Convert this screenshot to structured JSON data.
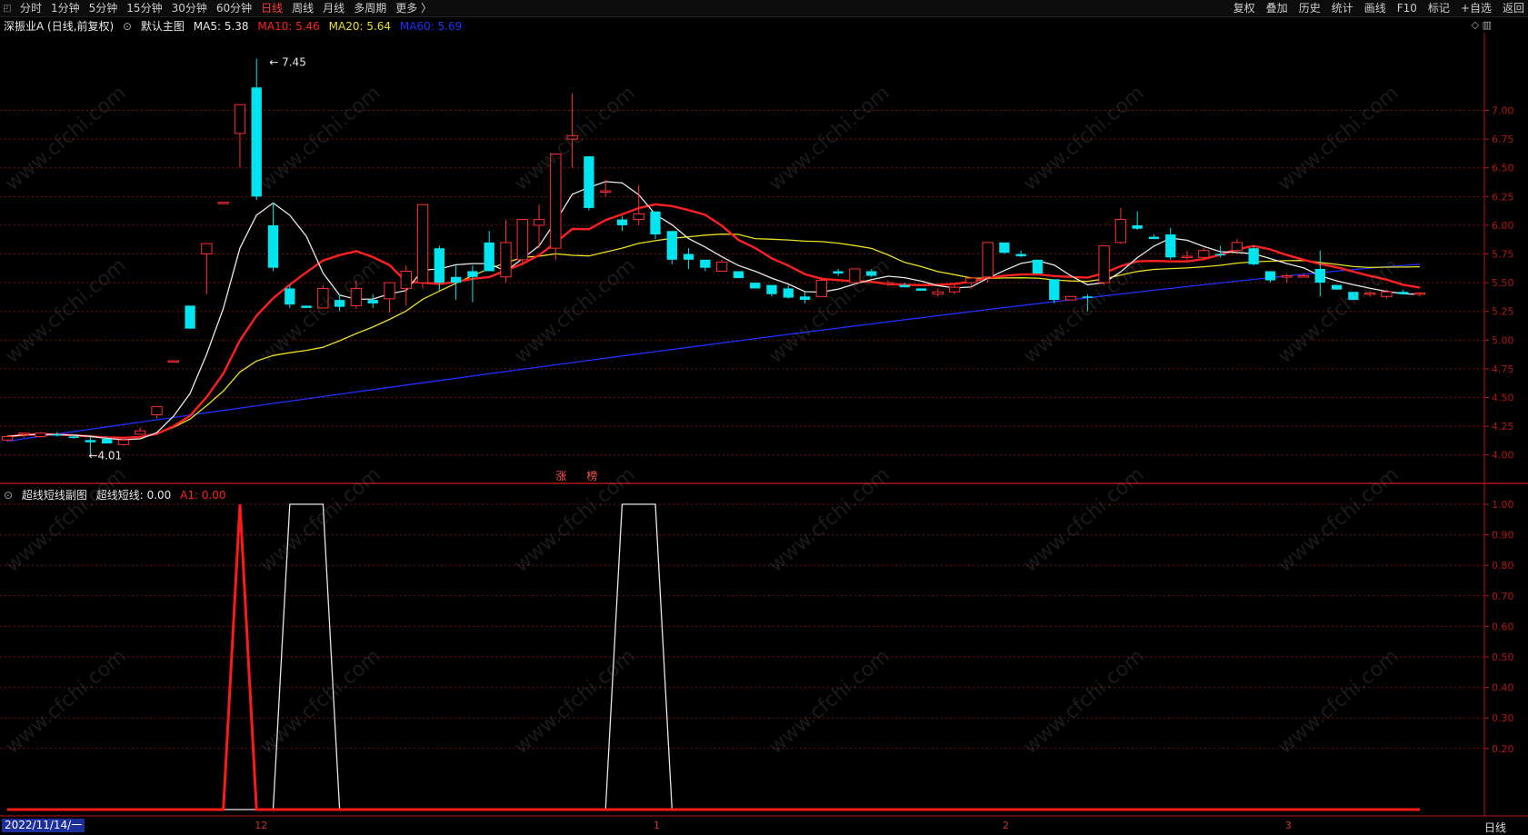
{
  "toolbar": {
    "periods": [
      "分时",
      "1分钟",
      "5分钟",
      "15分钟",
      "30分钟",
      "60分钟",
      "日线",
      "周线",
      "月线",
      "多周期",
      "更多 〉"
    ],
    "active_period": "日线",
    "right_buttons": [
      "复权",
      "叠加",
      "历史",
      "统计",
      "画线",
      "F10",
      "标记",
      "+自选",
      "返回"
    ]
  },
  "main_chart": {
    "stock_label": "深振业A (日线,前复权)",
    "template": "默认主图",
    "ma": [
      {
        "label": "MA5: 5.38",
        "color": "#e8e8e8"
      },
      {
        "label": "MA10: 5.46",
        "color": "#ff2020"
      },
      {
        "label": "MA20: 5.64",
        "color": "#e8e020"
      },
      {
        "label": "MA60: 5.69",
        "color": "#2030ff"
      }
    ],
    "high_label": "7.45",
    "low_label": "4.01",
    "marker_text": [
      "涨",
      "榜"
    ],
    "y_ticks": [
      "7.00",
      "6.75",
      "6.50",
      "6.25",
      "6.00",
      "5.75",
      "5.50",
      "5.25",
      "5.00",
      "4.75",
      "4.50",
      "4.25",
      "4.00"
    ]
  },
  "sub_chart": {
    "title": "超线短线副图",
    "line1": "超线短线: 0.00",
    "line2": "A1: 0.00",
    "y_ticks": [
      "1.00",
      "0.90",
      "0.80",
      "0.70",
      "0.60",
      "0.50",
      "0.40",
      "0.30",
      "0.20"
    ]
  },
  "x_axis": {
    "date": "2022/11/14/一",
    "months": [
      "12",
      "1",
      "2",
      "3"
    ],
    "period_label": "日线"
  },
  "watermark": "www.cfchi.com",
  "colors": {
    "up": "#ff3030",
    "down": "#00e5f0",
    "grid": "#7a1010",
    "frame": "#b01818"
  },
  "chart_data": [
    {
      "type": "candlestick",
      "title": "深振业A (日线,前复权)",
      "ylim": [
        3.8,
        7.55
      ],
      "series": [
        {
          "name": "MA5",
          "final": 5.38
        },
        {
          "name": "MA10",
          "final": 5.46
        },
        {
          "name": "MA20",
          "final": 5.64
        },
        {
          "name": "MA60",
          "final": 5.69
        }
      ],
      "ohlc": [
        [
          4.13,
          4.17,
          4.12,
          4.16
        ],
        [
          4.18,
          4.19,
          4.15,
          4.19
        ],
        [
          4.16,
          4.2,
          4.15,
          4.19
        ],
        [
          4.18,
          4.2,
          4.16,
          4.17
        ],
        [
          4.16,
          4.18,
          4.14,
          4.15
        ],
        [
          4.13,
          4.16,
          4.01,
          4.11
        ],
        [
          4.14,
          4.16,
          4.1,
          4.1
        ],
        [
          4.09,
          4.13,
          4.08,
          4.13
        ],
        [
          4.18,
          4.24,
          4.18,
          4.21
        ],
        [
          4.35,
          4.42,
          4.32,
          4.42
        ],
        [
          4.82,
          4.82,
          4.82,
          4.82
        ],
        [
          5.3,
          5.3,
          5.1,
          5.1
        ],
        [
          5.75,
          5.84,
          5.4,
          5.84
        ],
        [
          6.2,
          6.2,
          6.2,
          6.2
        ],
        [
          6.8,
          7.05,
          6.5,
          7.05
        ],
        [
          7.2,
          7.45,
          6.22,
          6.25
        ],
        [
          6.0,
          6.2,
          5.6,
          5.63
        ],
        [
          5.45,
          5.48,
          5.28,
          5.31
        ],
        [
          5.3,
          5.3,
          5.28,
          5.28
        ],
        [
          5.28,
          5.48,
          5.28,
          5.45
        ],
        [
          5.35,
          5.4,
          5.25,
          5.29
        ],
        [
          5.3,
          5.52,
          5.27,
          5.45
        ],
        [
          5.35,
          5.4,
          5.28,
          5.32
        ],
        [
          5.36,
          5.5,
          5.24,
          5.5
        ],
        [
          5.45,
          5.65,
          5.3,
          5.6
        ],
        [
          5.5,
          6.18,
          5.45,
          6.18
        ],
        [
          5.8,
          5.82,
          5.43,
          5.5
        ],
        [
          5.55,
          5.65,
          5.35,
          5.5
        ],
        [
          5.6,
          5.65,
          5.33,
          5.55
        ],
        [
          5.85,
          5.95,
          5.6,
          5.6
        ],
        [
          5.55,
          6.05,
          5.5,
          5.85
        ],
        [
          5.7,
          6.0,
          5.65,
          6.05
        ],
        [
          6.0,
          6.18,
          5.8,
          6.05
        ],
        [
          5.8,
          6.6,
          5.7,
          6.62
        ],
        [
          6.75,
          7.15,
          6.5,
          6.78
        ],
        [
          6.6,
          6.6,
          6.13,
          6.15
        ],
        [
          6.3,
          6.4,
          6.25,
          6.3
        ],
        [
          6.05,
          6.08,
          5.95,
          6.0
        ],
        [
          6.05,
          6.35,
          6.0,
          6.1
        ],
        [
          6.12,
          6.12,
          5.88,
          5.92
        ],
        [
          5.95,
          5.95,
          5.66,
          5.7
        ],
        [
          5.75,
          5.8,
          5.62,
          5.7
        ],
        [
          5.7,
          5.7,
          5.6,
          5.63
        ],
        [
          5.6,
          5.7,
          5.6,
          5.68
        ],
        [
          5.6,
          5.6,
          5.54,
          5.54
        ],
        [
          5.5,
          5.5,
          5.45,
          5.45
        ],
        [
          5.48,
          5.48,
          5.38,
          5.4
        ],
        [
          5.45,
          5.48,
          5.36,
          5.37
        ],
        [
          5.38,
          5.42,
          5.32,
          5.35
        ],
        [
          5.38,
          5.55,
          5.38,
          5.52
        ],
        [
          5.6,
          5.62,
          5.56,
          5.58
        ],
        [
          5.5,
          5.62,
          5.48,
          5.62
        ],
        [
          5.6,
          5.62,
          5.55,
          5.56
        ],
        [
          5.5,
          5.52,
          5.47,
          5.5
        ],
        [
          5.48,
          5.5,
          5.46,
          5.46
        ],
        [
          5.45,
          5.45,
          5.43,
          5.43
        ],
        [
          5.4,
          5.45,
          5.38,
          5.42
        ],
        [
          5.42,
          5.48,
          5.4,
          5.46
        ],
        [
          5.5,
          5.55,
          5.45,
          5.54
        ],
        [
          5.55,
          5.85,
          5.5,
          5.85
        ],
        [
          5.85,
          5.85,
          5.75,
          5.76
        ],
        [
          5.75,
          5.78,
          5.72,
          5.73
        ],
        [
          5.7,
          5.7,
          5.58,
          5.58
        ],
        [
          5.53,
          5.53,
          5.32,
          5.35
        ],
        [
          5.35,
          5.38,
          5.35,
          5.38
        ],
        [
          5.38,
          5.4,
          5.25,
          5.37
        ],
        [
          5.5,
          5.8,
          5.48,
          5.82
        ],
        [
          5.85,
          6.15,
          5.84,
          6.05
        ],
        [
          6.0,
          6.12,
          5.96,
          5.97
        ],
        [
          5.9,
          5.92,
          5.88,
          5.88
        ],
        [
          5.92,
          5.98,
          5.7,
          5.72
        ],
        [
          5.72,
          5.78,
          5.7,
          5.73
        ],
        [
          5.72,
          5.8,
          5.7,
          5.78
        ],
        [
          5.75,
          5.82,
          5.72,
          5.74
        ],
        [
          5.78,
          5.88,
          5.75,
          5.85
        ],
        [
          5.8,
          5.82,
          5.65,
          5.66
        ],
        [
          5.6,
          5.6,
          5.5,
          5.52
        ],
        [
          5.55,
          5.58,
          5.5,
          5.56
        ],
        [
          5.55,
          5.58,
          5.55,
          5.56
        ],
        [
          5.62,
          5.78,
          5.38,
          5.5
        ],
        [
          5.48,
          5.48,
          5.44,
          5.44
        ],
        [
          5.42,
          5.42,
          5.35,
          5.35
        ],
        [
          5.4,
          5.42,
          5.38,
          5.41
        ],
        [
          5.38,
          5.44,
          5.36,
          5.42
        ],
        [
          5.42,
          5.44,
          5.4,
          5.4
        ],
        [
          5.4,
          5.42,
          5.38,
          5.41
        ]
      ]
    },
    {
      "type": "line",
      "title": "超线短线副图",
      "ylim": [
        0.0,
        1.0
      ],
      "series": [
        {
          "name": "超线短线",
          "values": [
            0,
            0,
            0,
            0,
            0,
            0,
            0,
            0,
            0,
            0,
            0,
            0,
            0,
            0,
            0,
            0,
            0,
            1,
            1,
            1,
            0,
            0,
            0,
            0,
            0,
            0,
            0,
            0,
            0,
            0,
            0,
            0,
            0,
            0,
            0,
            0,
            0,
            1,
            1,
            1,
            0,
            0,
            0,
            0,
            0,
            0,
            0,
            0,
            0,
            0,
            0,
            0,
            0,
            0,
            0,
            0,
            0,
            0,
            0,
            0,
            0,
            0,
            0,
            0,
            0,
            0,
            0,
            0,
            0,
            0,
            0,
            0,
            0,
            0,
            0,
            0,
            0,
            0,
            0,
            0,
            0,
            0,
            0,
            0,
            0,
            0
          ]
        },
        {
          "name": "A1",
          "values": [
            0,
            0,
            0,
            0,
            0,
            0,
            0,
            0,
            0,
            0,
            0,
            0,
            0,
            0,
            1,
            0,
            0,
            0,
            0,
            0,
            0,
            0,
            0,
            0,
            0,
            0,
            0,
            0,
            0,
            0,
            0,
            0,
            0,
            0,
            0,
            0,
            0,
            0,
            0,
            0,
            0,
            0,
            0,
            0,
            0,
            0,
            0,
            0,
            0,
            0,
            0,
            0,
            0,
            0,
            0,
            0,
            0,
            0,
            0,
            0,
            0,
            0,
            0,
            0,
            0,
            0,
            0,
            0,
            0,
            0,
            0,
            0,
            0,
            0,
            0,
            0,
            0,
            0,
            0,
            0,
            0,
            0,
            0,
            0,
            0,
            0
          ]
        }
      ]
    }
  ]
}
